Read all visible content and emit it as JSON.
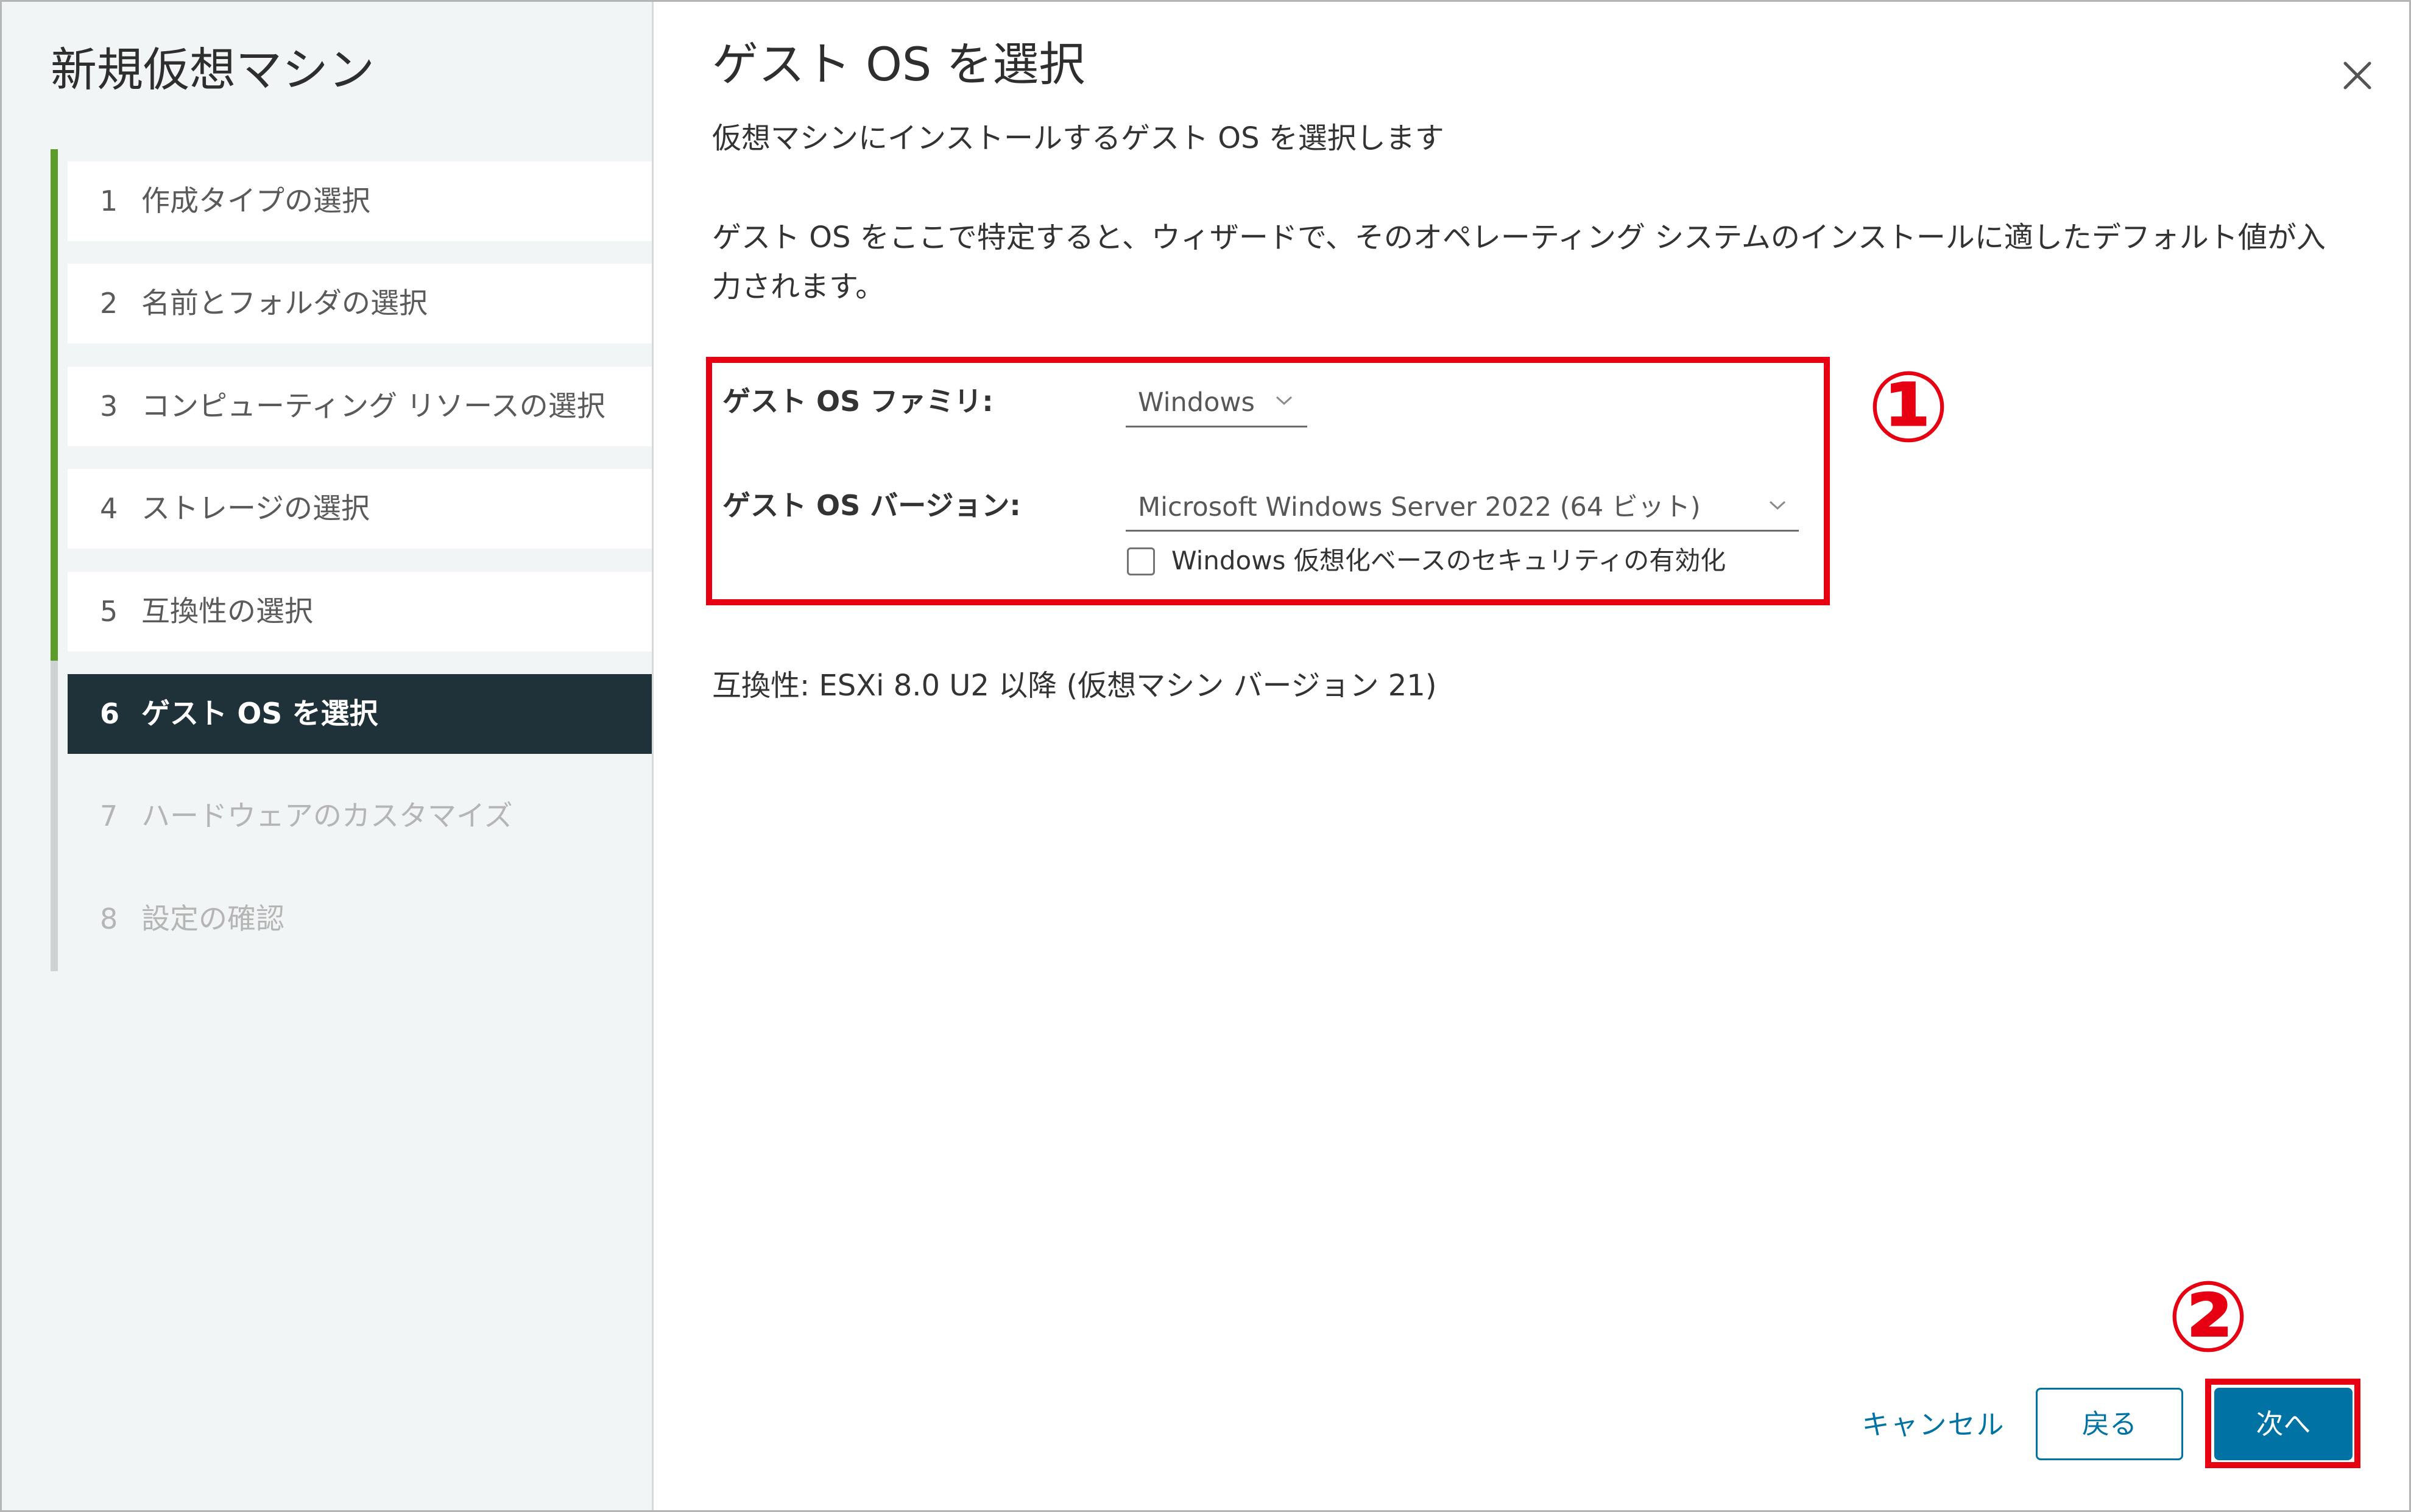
{
  "window": {
    "title": "新規仮想マシン"
  },
  "steps": [
    {
      "number": "1",
      "label": "作成タイプの選択",
      "completed": true,
      "current": false
    },
    {
      "number": "2",
      "label": "名前とフォルダの選択",
      "completed": true,
      "current": false
    },
    {
      "number": "3",
      "label": "コンピューティング リソースの選択",
      "completed": true,
      "current": false
    },
    {
      "number": "4",
      "label": "ストレージの選択",
      "completed": true,
      "current": false
    },
    {
      "number": "5",
      "label": "互換性の選択",
      "completed": true,
      "current": false
    },
    {
      "number": "6",
      "label": "ゲスト OS を選択",
      "completed": false,
      "current": true
    },
    {
      "number": "7",
      "label": "ハードウェアのカスタマイズ",
      "completed": false,
      "current": false
    },
    {
      "number": "8",
      "label": "設定の確認",
      "completed": false,
      "current": false
    }
  ],
  "page": {
    "title": "ゲスト OS を選択",
    "subtitle": "仮想マシンにインストールするゲスト OS を選択します",
    "description": "ゲスト OS をここで特定すると、ウィザードで、そのオペレーティング システムのインストールに適したデフォルト値が入力されます。",
    "close_icon": "close-icon"
  },
  "form": {
    "family_label": "ゲスト OS ファミリ:",
    "family_value": "Windows",
    "version_label": "ゲスト OS バージョン:",
    "version_value": "Microsoft Windows Server 2022 (64 ビット)",
    "select_icon": "chevron-down-icon",
    "vbs_checkbox": {
      "label": "Windows 仮想化ベースのセキュリティの有効化",
      "checked": false
    }
  },
  "compatibility": "互換性: ESXi 8.0 U2 以降 (仮想マシン バージョン 21)",
  "footer": {
    "cancel_label": "キャンセル",
    "back_label": "戻る",
    "next_label": "次へ"
  },
  "annotations": {
    "marker_1": "①",
    "marker_2": "②"
  },
  "colors": {
    "accent": "#0072a3",
    "annotation_red": "#e60012",
    "step_done": "#5b9c2b",
    "step_current_bg": "#1f3139",
    "sidebar_bg": "#f2f5f5"
  }
}
